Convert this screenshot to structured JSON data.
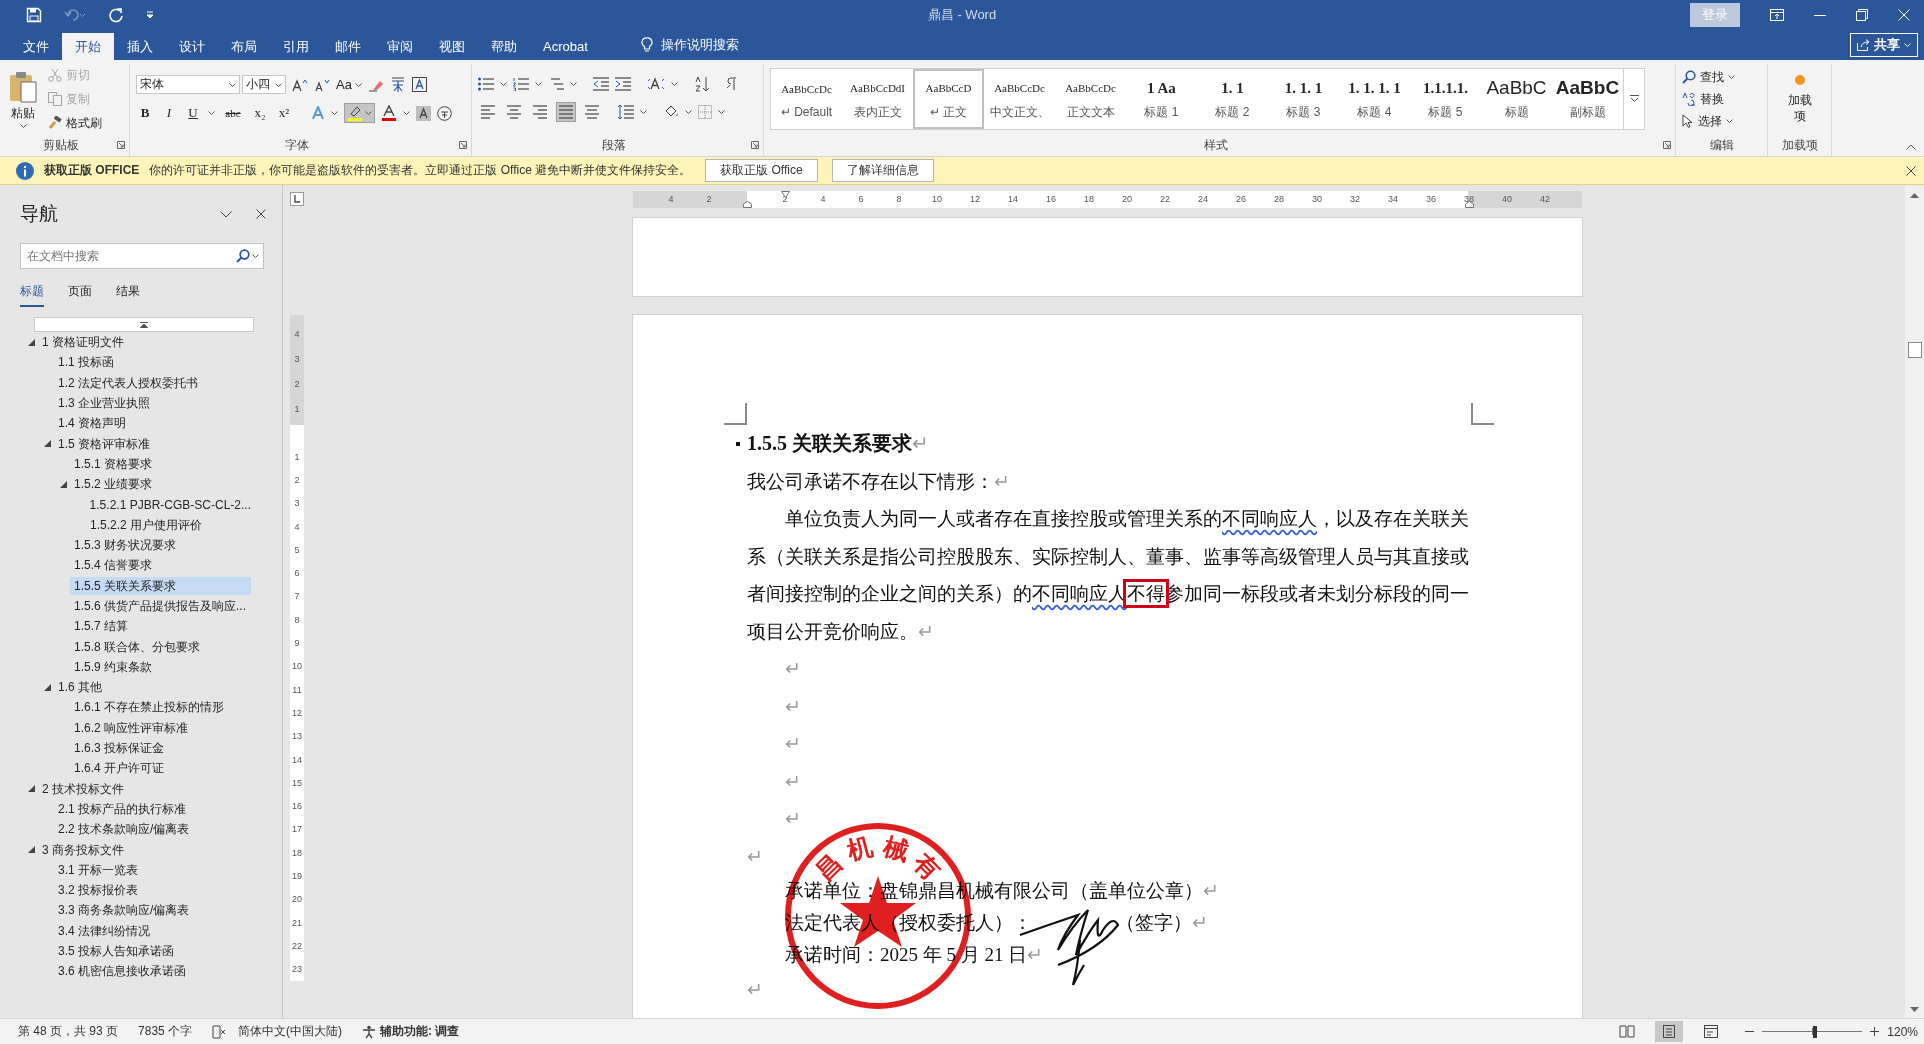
{
  "window": {
    "title": "鼎昌 - Word",
    "sign_in": "登录",
    "share": "共享"
  },
  "menu_tabs": [
    {
      "label": "文件",
      "selected": false
    },
    {
      "label": "开始",
      "selected": true
    },
    {
      "label": "插入",
      "selected": false
    },
    {
      "label": "设计",
      "selected": false
    },
    {
      "label": "布局",
      "selected": false
    },
    {
      "label": "引用",
      "selected": false
    },
    {
      "label": "邮件",
      "selected": false
    },
    {
      "label": "审阅",
      "selected": false
    },
    {
      "label": "视图",
      "selected": false
    },
    {
      "label": "帮助",
      "selected": false
    },
    {
      "label": "Acrobat",
      "selected": false
    }
  ],
  "tell_me": "操作说明搜索",
  "ribbon": {
    "clipboard": {
      "title": "剪贴板",
      "paste": "粘贴",
      "items": [
        {
          "kind": "cut",
          "label": "剪切",
          "disabled": true
        },
        {
          "kind": "copy",
          "label": "复制",
          "disabled": true
        },
        {
          "kind": "format_painter",
          "label": "格式刷",
          "disabled": false
        }
      ]
    },
    "font": {
      "title": "字体",
      "font_name": "宋体",
      "font_size": "小四",
      "change_case": "Aa",
      "format_buttons": [
        "B",
        "I",
        "U",
        "abc",
        "x₂",
        "x²"
      ]
    },
    "paragraph": {
      "title": "段落",
      "alignments": [
        {
          "kind": "left",
          "selected": false
        },
        {
          "kind": "center",
          "selected": false
        },
        {
          "kind": "right",
          "selected": false
        },
        {
          "kind": "justify",
          "selected": true
        },
        {
          "kind": "distributed",
          "selected": false
        }
      ]
    },
    "styles": {
      "title": "样式",
      "items": [
        {
          "kind": "paragraph",
          "preview": "AaBbCcDc",
          "name": "↵ Default",
          "selected": false
        },
        {
          "kind": "paragraph",
          "preview": "AaBbCcDdI",
          "name": "表内正文",
          "selected": false
        },
        {
          "kind": "paragraph",
          "preview": "AaBbCcD",
          "name": "↵ 正文",
          "selected": true
        },
        {
          "kind": "paragraph",
          "preview": "AaBbCcDc",
          "name": "中文正文、",
          "selected": false
        },
        {
          "kind": "paragraph",
          "preview": "AaBbCcDc",
          "name": "正文文本",
          "selected": false
        },
        {
          "kind": "heading",
          "preview": "1 Aa",
          "name": "标题 1",
          "selected": false
        },
        {
          "kind": "heading",
          "preview": "1. 1",
          "name": "标题 2",
          "selected": false
        },
        {
          "kind": "heading",
          "preview": "1. 1. 1",
          "name": "标题 3",
          "selected": false
        },
        {
          "kind": "heading",
          "preview": "1. 1. 1. 1",
          "name": "标题 4",
          "selected": false
        },
        {
          "kind": "heading",
          "preview": "1.1.1.1.",
          "name": "标题 5",
          "selected": false
        },
        {
          "kind": "title",
          "preview": "AaBbC",
          "name": "标题",
          "selected": false
        },
        {
          "kind": "subtitle",
          "preview": "AaBbC",
          "name": "副标题",
          "selected": false
        }
      ]
    },
    "editing": {
      "title": "编辑",
      "items": [
        {
          "kind": "find",
          "label": "查找"
        },
        {
          "kind": "replace",
          "label": "替换"
        },
        {
          "kind": "select",
          "label": "选择"
        }
      ]
    },
    "addins": {
      "title": "加载项",
      "button": "加载项"
    }
  },
  "info_bar": {
    "title": "获取正版 OFFICE",
    "message": "你的许可证并非正版，你可能是盗版软件的受害者。立即通过正版 Office 避免中断并使文件保持安全。",
    "buttons": [
      "获取正版 Office",
      "了解详细信息"
    ]
  },
  "nav": {
    "title": "导航",
    "search_placeholder": "在文档中搜索",
    "tabs": [
      {
        "label": "标题",
        "selected": true
      },
      {
        "label": "页面",
        "selected": false
      },
      {
        "label": "结果",
        "selected": false
      }
    ],
    "tree": [
      {
        "label": "1 资格证明文件",
        "expanded": true,
        "selected": false,
        "children": [
          {
            "label": "1.1 投标函",
            "selected": false
          },
          {
            "label": "1.2 法定代表人授权委托书",
            "selected": false
          },
          {
            "label": "1.3 企业营业执照",
            "selected": false
          },
          {
            "label": "1.4 资格声明",
            "selected": false
          },
          {
            "label": "1.5 资格评审标准",
            "expanded": true,
            "selected": false,
            "children": [
              {
                "label": "1.5.1 资格要求",
                "selected": false
              },
              {
                "label": "1.5.2 业绩要求",
                "expanded": true,
                "selected": false,
                "children": [
                  {
                    "label": "1.5.2.1 PJBR-CGB-SC-CL-2...",
                    "selected": false
                  },
                  {
                    "label": "1.5.2.2 用户使用评价",
                    "selected": false
                  }
                ]
              },
              {
                "label": "1.5.3 财务状况要求",
                "selected": false
              },
              {
                "label": "1.5.4 信誉要求",
                "selected": false
              },
              {
                "label": "1.5.5 关联关系要求",
                "selected": true
              },
              {
                "label": "1.5.6 供货产品提供报告及响应...",
                "selected": false
              },
              {
                "label": "1.5.7 结算",
                "selected": false
              },
              {
                "label": "1.5.8 联合体、分包要求",
                "selected": false
              },
              {
                "label": "1.5.9 约束条款",
                "selected": false
              }
            ]
          },
          {
            "label": "1.6 其他",
            "expanded": true,
            "selected": false,
            "children": [
              {
                "label": "1.6.1 不存在禁止投标的情形",
                "selected": false
              },
              {
                "label": "1.6.2 响应性评审标准",
                "selected": false
              },
              {
                "label": "1.6.3 投标保证金",
                "selected": false
              },
              {
                "label": "1.6.4 开户许可证",
                "selected": false
              }
            ]
          }
        ]
      },
      {
        "label": "2 技术投标文件",
        "expanded": true,
        "selected": false,
        "children": [
          {
            "label": "2.1 投标产品的执行标准",
            "selected": false
          },
          {
            "label": "2.2 技术条款响应/偏离表",
            "selected": false
          }
        ]
      },
      {
        "label": "3 商务投标文件",
        "expanded": true,
        "selected": false,
        "children": [
          {
            "label": "3.1 开标一览表",
            "selected": false
          },
          {
            "label": "3.2 投标报价表",
            "selected": false
          },
          {
            "label": "3.3 商务条款响应/偏离表",
            "selected": false
          },
          {
            "label": "3.4 法律纠纷情况",
            "selected": false
          },
          {
            "label": "3.5 投标人告知承诺函",
            "selected": false
          },
          {
            "label": "3.6 机密信息接收承诺函",
            "selected": false
          }
        ]
      }
    ]
  },
  "ruler": {
    "left_labels": [
      "4",
      "2"
    ],
    "labels": [
      "2",
      "4",
      "6",
      "8",
      "10",
      "12",
      "14",
      "16",
      "18",
      "20",
      "22",
      "24",
      "26",
      "28",
      "30",
      "32",
      "34",
      "36",
      "38",
      "40",
      "42"
    ]
  },
  "vertical_ruler": {
    "top_labels": [
      "4",
      "3",
      "2",
      "1"
    ],
    "labels": [
      "1",
      "2",
      "3",
      "4",
      "5",
      "6",
      "7",
      "8",
      "9",
      "10",
      "11",
      "12",
      "13",
      "14",
      "15",
      "16",
      "17",
      "18",
      "19",
      "20",
      "21",
      "22",
      "23"
    ]
  },
  "page": {
    "paragraphs": [
      {
        "kind": "heading",
        "segments": [
          {
            "kind": "plain",
            "text": "1.5.5  关联关系要求"
          }
        ],
        "end_mark": "↵"
      },
      {
        "kind": "body",
        "segments": [
          {
            "kind": "plain",
            "text": "我公司承诺不存在以下情形："
          }
        ],
        "end_mark": "↵"
      },
      {
        "kind": "indented",
        "segments": [
          {
            "kind": "plain",
            "text": "单位负责人为同一人或者存在直接控股或管理关系的"
          },
          {
            "kind": "flagged",
            "text": "不同响应人"
          },
          {
            "kind": "plain",
            "text": "，以及存在关联关系（关联关系是指公司控股股东、实际控制人、董事、监事等高级管理人员与其直接或者间接控制的企业之间的关系）的"
          },
          {
            "kind": "flagged",
            "text": "不同响应人"
          },
          {
            "kind": "framed",
            "text": "不得"
          },
          {
            "kind": "plain",
            "text": "参加同一标段或者未划分标段的同一项目公开竞价响应。"
          }
        ],
        "end_mark": "↵"
      },
      {
        "kind": "indented",
        "end_mark": "↵"
      },
      {
        "kind": "indented",
        "end_mark": "↵"
      },
      {
        "kind": "indented",
        "end_mark": "↵"
      },
      {
        "kind": "indented",
        "end_mark": "↵"
      },
      {
        "kind": "indented",
        "end_mark": "↵"
      },
      {
        "kind": "body",
        "end_mark": "↵"
      },
      {
        "kind": "signature",
        "segments": [
          {
            "kind": "plain",
            "text": "承诺单位：盘锦鼎昌机械有限公司（盖单位公章）"
          }
        ],
        "end_mark": "↵"
      },
      {
        "kind": "signature",
        "segments": [
          {
            "kind": "plain",
            "text": "法定代表人（授权委托人）："
          },
          {
            "kind": "after_signature",
            "text": "（签字）"
          }
        ],
        "end_mark": "↵"
      },
      {
        "kind": "signature",
        "segments": [
          {
            "kind": "plain",
            "text": "承诺时间：2025 年 5 月 21 日"
          }
        ],
        "end_mark": "↵"
      },
      {
        "kind": "body",
        "end_mark": "↵"
      }
    ],
    "stamp": {
      "text": "昌机械有"
    }
  },
  "status": {
    "page": "第 48 页，共 93 页",
    "words": "7835 个字",
    "language": "简体中文(中国大陆)",
    "accessibility": "辅助功能: 调查",
    "views": [
      {
        "kind": "read",
        "selected": false
      },
      {
        "kind": "print",
        "selected": true
      },
      {
        "kind": "web",
        "selected": false
      }
    ],
    "zoom": {
      "level": 0.53,
      "label": "120%"
    }
  }
}
